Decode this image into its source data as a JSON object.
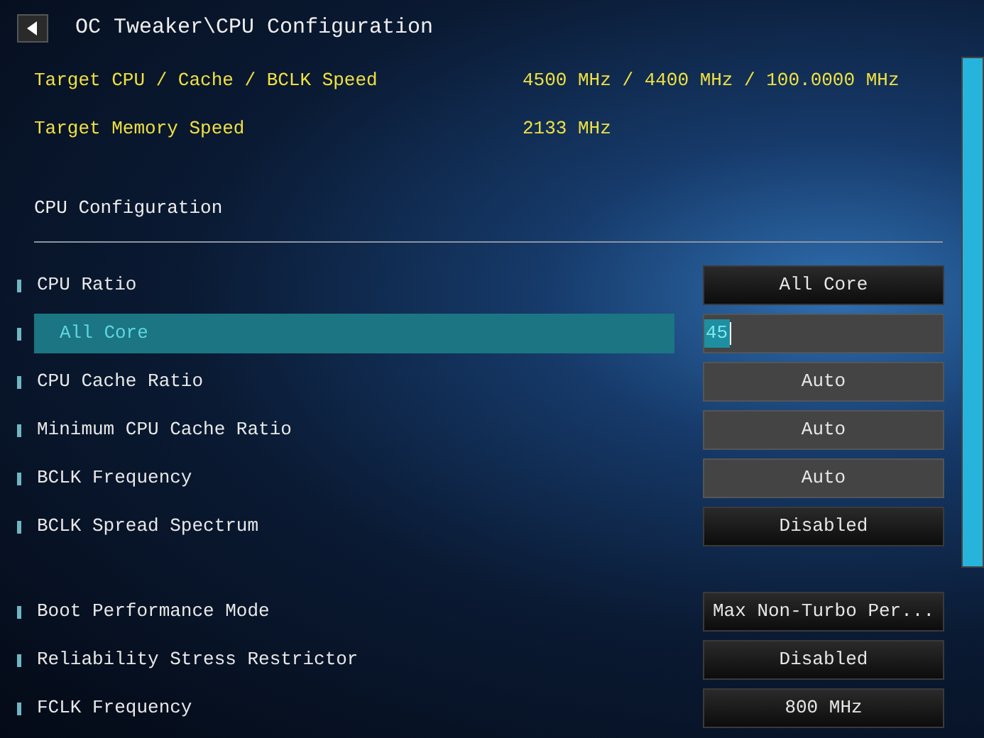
{
  "header": {
    "title": "OC Tweaker\\CPU Configuration"
  },
  "info": [
    {
      "label": "Target CPU / Cache / BCLK Speed",
      "value": "4500 MHz / 4400 MHz / 100.0000 MHz"
    },
    {
      "label": "Target Memory Speed",
      "value": "2133 MHz"
    }
  ],
  "section_title": "CPU Configuration",
  "groups": [
    {
      "items": [
        {
          "label": "CPU Ratio",
          "value": "All Core",
          "kind": "select",
          "selected": false,
          "children": [
            {
              "label": "All Core",
              "value": "45",
              "kind": "input",
              "selected": true
            }
          ]
        },
        {
          "label": "CPU Cache Ratio",
          "value": "Auto",
          "kind": "input",
          "selected": false
        },
        {
          "label": "Minimum CPU Cache Ratio",
          "value": "Auto",
          "kind": "input",
          "selected": false
        },
        {
          "label": "BCLK Frequency",
          "value": "Auto",
          "kind": "input",
          "selected": false
        },
        {
          "label": "BCLK Spread Spectrum",
          "value": "Disabled",
          "kind": "select",
          "selected": false
        }
      ]
    },
    {
      "items": [
        {
          "label": "Boot Performance Mode",
          "value": "Max Non-Turbo Per...",
          "kind": "select",
          "selected": false
        },
        {
          "label": "Reliability Stress Restrictor",
          "value": "Disabled",
          "kind": "select",
          "selected": false
        },
        {
          "label": "FCLK Frequency",
          "value": "800 MHz",
          "kind": "select",
          "selected": false
        }
      ]
    }
  ]
}
